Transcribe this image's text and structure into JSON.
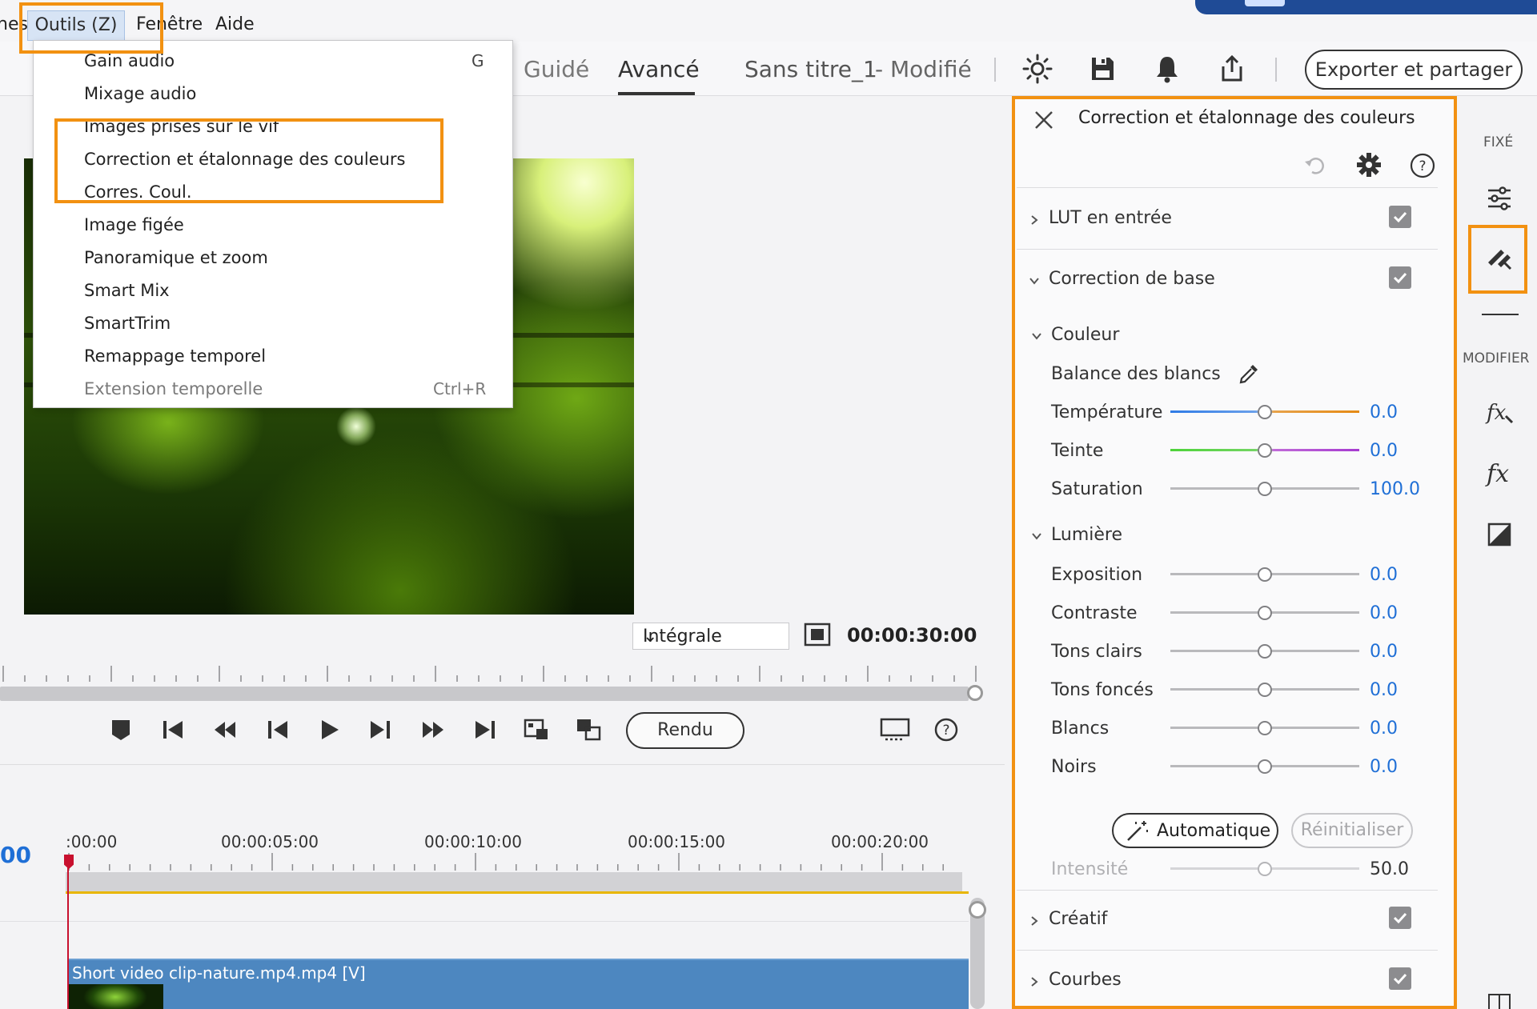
{
  "menubar": {
    "items": [
      "nes",
      "Outils (Z)",
      "Fenêtre",
      "Aide"
    ]
  },
  "toolbar": {
    "tabs": [
      "Guidé",
      "Avancé"
    ],
    "document_title": "Sans titre_1",
    "document_status": "- Modifié",
    "export_label": "Exporter et partager",
    "icons": [
      "brightness-icon",
      "save-icon",
      "bell-icon",
      "share-icon"
    ]
  },
  "dropdown": {
    "items": [
      {
        "label": "Gain audio",
        "shortcut": "G",
        "enabled": true
      },
      {
        "label": "Mixage audio",
        "shortcut": "",
        "enabled": true
      },
      {
        "label": "Images prises sur le vif",
        "shortcut": "",
        "enabled": true
      },
      {
        "label": "Correction et étalonnage des couleurs",
        "shortcut": "",
        "enabled": true
      },
      {
        "label": "Corres. Coul.",
        "shortcut": "",
        "enabled": true
      },
      {
        "label": "Image figée",
        "shortcut": "",
        "enabled": true
      },
      {
        "label": "Panoramique et zoom",
        "shortcut": "",
        "enabled": true
      },
      {
        "label": "Smart Mix",
        "shortcut": "",
        "enabled": true
      },
      {
        "label": "SmartTrim",
        "shortcut": "",
        "enabled": true
      },
      {
        "label": "Remappage temporel",
        "shortcut": "",
        "enabled": true
      },
      {
        "label": "Extension temporelle",
        "shortcut": "Ctrl+R",
        "enabled": false
      }
    ]
  },
  "monitor": {
    "quality": "Intégrale",
    "total_time": "00:00:30:00",
    "render_label": "Rendu"
  },
  "timeline": {
    "current_time": "00",
    "ruler_labels": [
      ":00:00",
      "00:00:05:00",
      "00:00:10:00",
      "00:00:15:00",
      "00:00:20:00"
    ],
    "clip_label": "Short video clip-nature.mp4.mp4 [V]"
  },
  "panel": {
    "title": "Correction et étalonnage des couleurs",
    "sections": {
      "lut": "LUT en entrée",
      "basic": "Correction de base",
      "color": "Couleur",
      "light": "Lumière",
      "creative": "Créatif",
      "curves": "Courbes"
    },
    "white_balance": "Balance des blancs",
    "color_rows": [
      {
        "label": "Température",
        "value": "0.0",
        "level": 0.5
      },
      {
        "label": "Teinte",
        "value": "0.0",
        "level": 0.5
      },
      {
        "label": "Saturation",
        "value": "100.0",
        "level": 0.5
      }
    ],
    "light_rows": [
      {
        "label": "Exposition",
        "value": "0.0",
        "level": 0.5
      },
      {
        "label": "Contraste",
        "value": "0.0",
        "level": 0.5
      },
      {
        "label": "Tons clairs",
        "value": "0.0",
        "level": 0.5
      },
      {
        "label": "Tons foncés",
        "value": "0.0",
        "level": 0.5
      },
      {
        "label": "Blancs",
        "value": "0.0",
        "level": 0.5
      },
      {
        "label": "Noirs",
        "value": "0.0",
        "level": 0.5
      }
    ],
    "auto_label": "Automatique",
    "reset_label": "Réinitialiser",
    "intensity": {
      "label": "Intensité",
      "value": "50.0",
      "level": 0.5
    },
    "colors": {
      "accent": "#1f6fd6",
      "highlight": "#f29111"
    }
  },
  "rail": {
    "pinned_label": "FIXÉ",
    "modify_label": "MODIFIER"
  }
}
